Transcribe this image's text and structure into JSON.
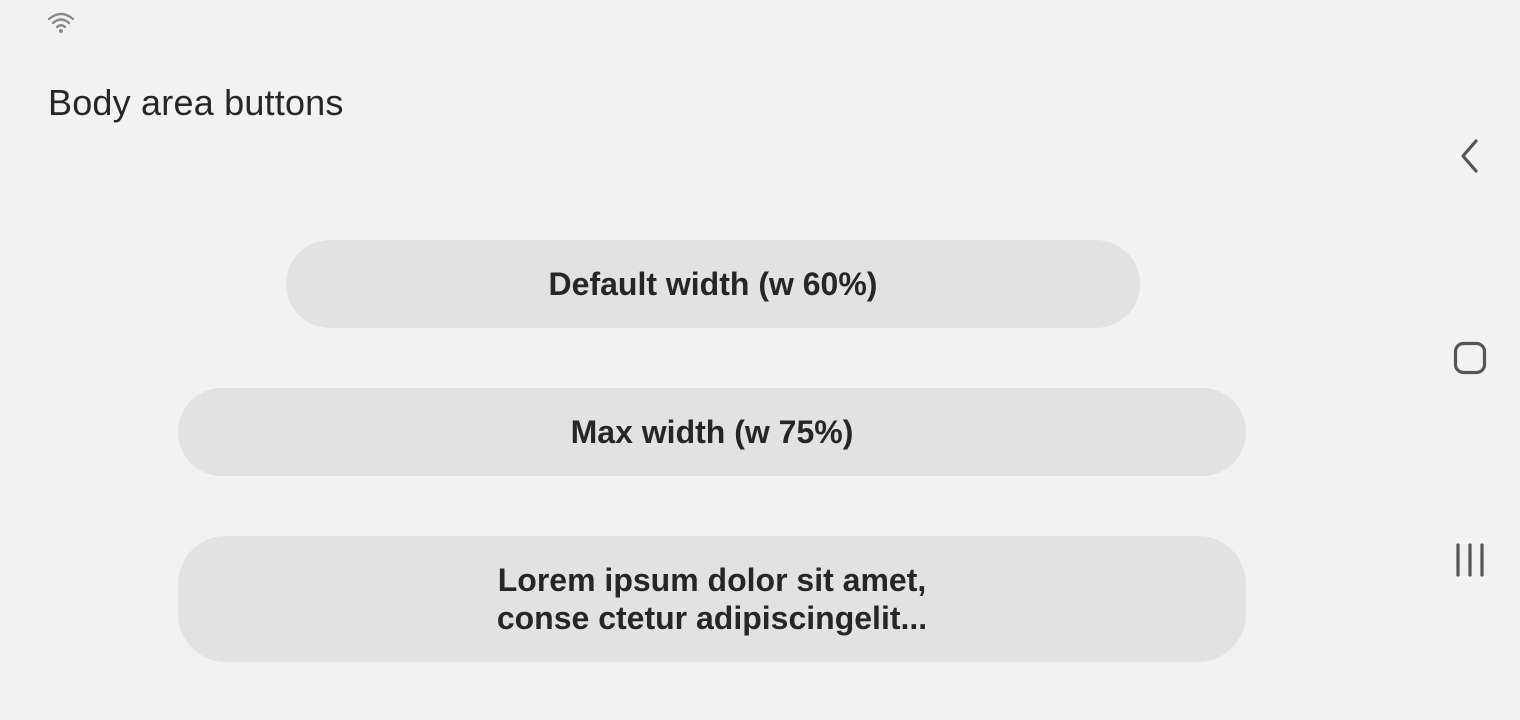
{
  "status_bar": {
    "icons": [
      "wifi-icon"
    ]
  },
  "page": {
    "title": "Body area buttons"
  },
  "buttons": {
    "default_width": "Default width (w 60%)",
    "max_width": "Max width (w 75%)",
    "long_text_line1": "Lorem ipsum dolor sit amet,",
    "long_text_line2": "conse ctetur adipiscingelit..."
  },
  "navigation_bar": {
    "icons": [
      "back-icon",
      "home-icon",
      "recent-apps-icon"
    ]
  },
  "colors": {
    "background": "#f2f2f2",
    "button_background": "#e2e2e2",
    "text": "#262626",
    "icon": "#555555"
  }
}
